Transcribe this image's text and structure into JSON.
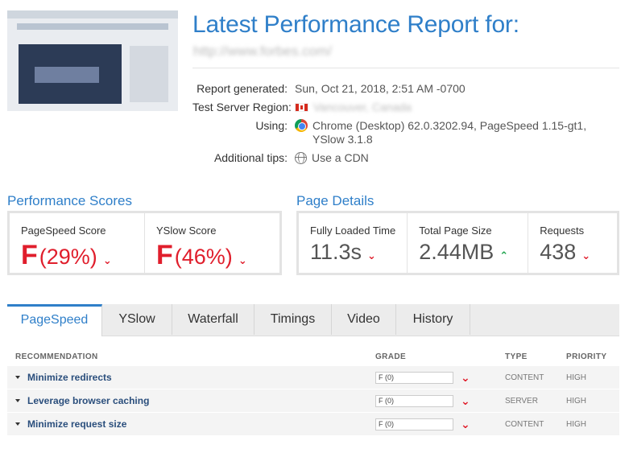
{
  "header": {
    "title": "Latest Performance Report for:",
    "url": "http://www.forbes.com/"
  },
  "meta": {
    "report_generated_label": "Report generated:",
    "report_generated_value": "Sun, Oct 21, 2018, 2:51 AM -0700",
    "server_region_label": "Test Server Region:",
    "server_region_value": "Vancouver, Canada",
    "using_label": "Using:",
    "using_value_line1": "Chrome (Desktop) 62.0.3202.94, PageSpeed 1.15-gt1,",
    "using_value_line2": "YSlow 3.1.8",
    "tips_label": "Additional tips:",
    "tips_value": "Use a CDN",
    "flag_icon": "canada-flag-icon",
    "browser_icon": "chrome-icon",
    "tips_icon": "globe-icon"
  },
  "performance": {
    "title": "Performance Scores",
    "pagespeed_label": "PageSpeed Score",
    "pagespeed_grade": "F",
    "pagespeed_pct": "(29%)",
    "yslow_label": "YSlow Score",
    "yslow_grade": "F",
    "yslow_pct": "(46%)"
  },
  "details": {
    "title": "Page Details",
    "load_time_label": "Fully Loaded Time",
    "load_time_value": "11.3s",
    "page_size_label": "Total Page Size",
    "page_size_value": "2.44MB",
    "requests_label": "Requests",
    "requests_value": "438"
  },
  "tabs": [
    "PageSpeed",
    "YSlow",
    "Waterfall",
    "Timings",
    "Video",
    "History"
  ],
  "table": {
    "headers": {
      "recommendation": "RECOMMENDATION",
      "grade": "GRADE",
      "type": "TYPE",
      "priority": "PRIORITY"
    },
    "rows": [
      {
        "recommendation": "Minimize redirects",
        "grade": "F (0)",
        "type": "CONTENT",
        "priority": "HIGH"
      },
      {
        "recommendation": "Leverage browser caching",
        "grade": "F (0)",
        "type": "SERVER",
        "priority": "HIGH"
      },
      {
        "recommendation": "Minimize request size",
        "grade": "F (0)",
        "type": "CONTENT",
        "priority": "HIGH"
      }
    ]
  },
  "colors": {
    "accent": "#2f7fc9",
    "bad": "#e01e2c",
    "good": "#1aa34a"
  }
}
